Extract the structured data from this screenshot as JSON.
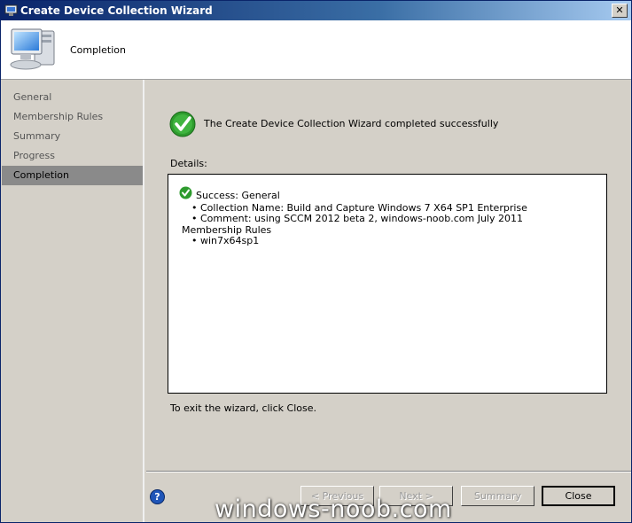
{
  "window": {
    "title": "Create Device Collection Wizard",
    "close_glyph": "✕"
  },
  "header": {
    "title": "Completion",
    "icon": "computer-icon"
  },
  "nav": {
    "items": [
      {
        "label": "General",
        "active": false
      },
      {
        "label": "Membership Rules",
        "active": false
      },
      {
        "label": "Summary",
        "active": false
      },
      {
        "label": "Progress",
        "active": false
      },
      {
        "label": "Completion",
        "active": true
      }
    ]
  },
  "main": {
    "success_message": "The Create Device Collection Wizard completed successfully",
    "details_label": "Details:",
    "details": {
      "line1": "Success: General",
      "line2": "• Collection Name: Build and Capture Windows 7 X64 SP1 Enterprise",
      "line3": "• Comment: using SCCM 2012 beta 2, windows-noob.com July 2011",
      "line4": "Membership Rules",
      "line5": "• win7x64sp1"
    },
    "exit_text": "To exit the wizard, click Close."
  },
  "footer": {
    "help_glyph": "?",
    "previous": "< Previous",
    "next": "Next >",
    "summary": "Summary",
    "close": "Close"
  },
  "watermark": "windows-noob.com",
  "colors": {
    "titlebar": "#0a246a",
    "background": "#d4d0c8",
    "success_green": "#2e9b2e",
    "active_nav": "#8a8a8a"
  }
}
